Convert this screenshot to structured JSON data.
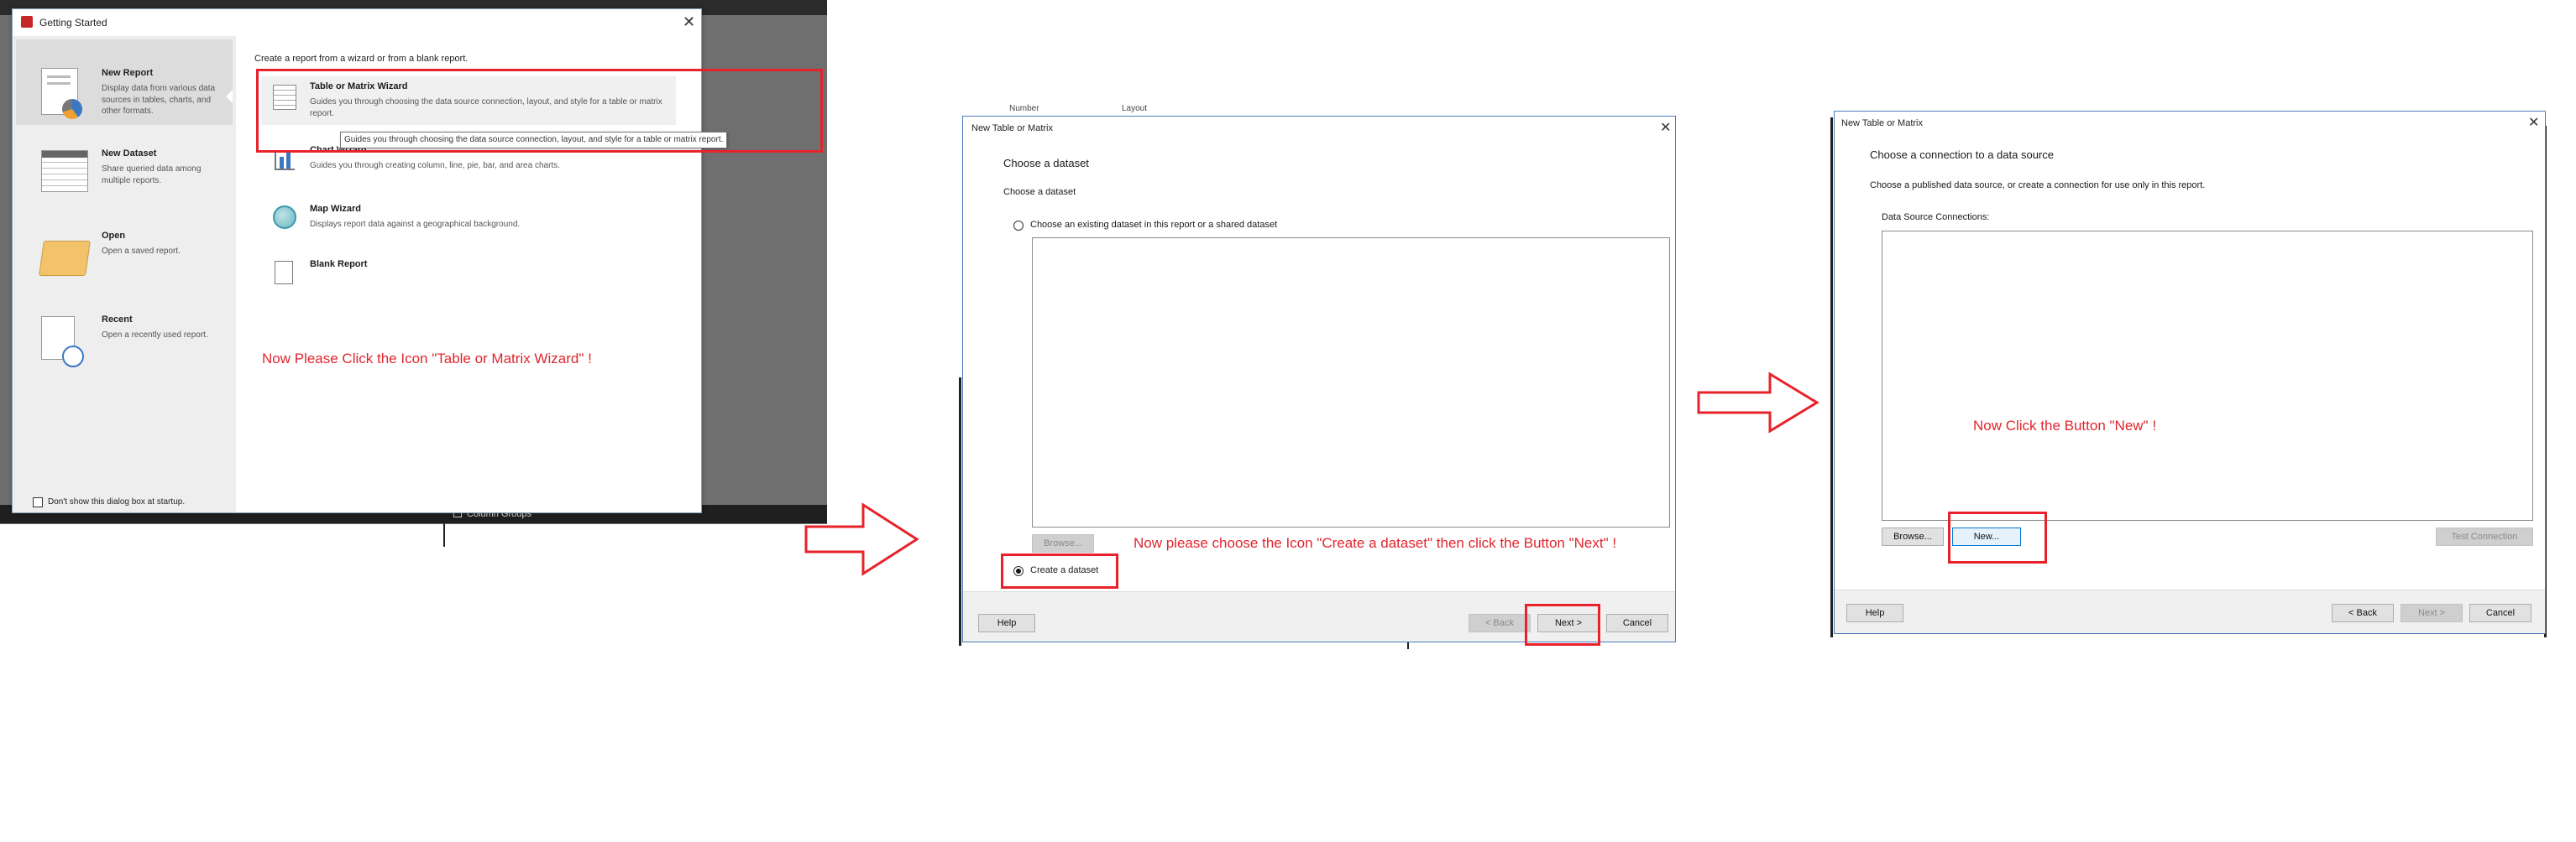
{
  "panel1": {
    "title": "Getting Started",
    "left_items": [
      {
        "title": "New Report",
        "desc": "Display data from various data sources in tables, charts, and other formats."
      },
      {
        "title": "New Dataset",
        "desc": "Share queried data among multiple reports."
      },
      {
        "title": "Open",
        "desc": "Open a saved report."
      },
      {
        "title": "Recent",
        "desc": "Open a recently used report."
      }
    ],
    "dont_show_label": "Don't show this dialog box at startup.",
    "intro": "Create a report from a wizard or from a blank report.",
    "wizards": [
      {
        "title": "Table or Matrix Wizard",
        "desc": "Guides you through choosing the data source connection, layout, and style for a table or matrix report."
      },
      {
        "title": "Chart Wizard",
        "desc": "Guides you through creating column, line, pie, bar, and area charts."
      },
      {
        "title": "Map Wizard",
        "desc": "Displays report data against a geographical background."
      },
      {
        "title": "Blank Report",
        "desc": ""
      }
    ],
    "tooltip": "Guides you through choosing the data source connection, layout, and style for a table or matrix report.",
    "annotation": "Now Please Click the Icon \"Table or Matrix Wizard\" !",
    "bg_label": "Column Groups"
  },
  "panel2": {
    "bg_tabs": [
      "Number",
      "Layout"
    ],
    "title": "New Table or Matrix",
    "heading": "Choose a dataset",
    "subheading": "Choose a dataset",
    "option_existing": "Choose an existing dataset in this report or a shared dataset",
    "browse_label": "Browse...",
    "option_create": "Create a dataset",
    "annotation": "Now please choose the Icon \"Create a dataset\" then click the Button \"Next\" !",
    "help_label": "Help",
    "back_label": "< Back",
    "next_label": "Next >",
    "cancel_label": "Cancel"
  },
  "panel3": {
    "title": "New Table or Matrix",
    "heading": "Choose a connection to a data source",
    "subheading": "Choose a published data source, or create a connection for use only in this report.",
    "connections_label": "Data Source Connections:",
    "browse_label": "Browse...",
    "new_label": "New...",
    "test_label": "Test Connection",
    "annotation": "Now Click the Button \"New\" !",
    "help_label": "Help",
    "back_label": "< Back",
    "next_label": "Next >",
    "cancel_label": "Cancel"
  },
  "colors": {
    "annotation_red": "#e8222a",
    "dialog_bg": "#ffffff",
    "sidebar_bg": "#eeeeef",
    "footer_bg": "#f0f0f0"
  }
}
